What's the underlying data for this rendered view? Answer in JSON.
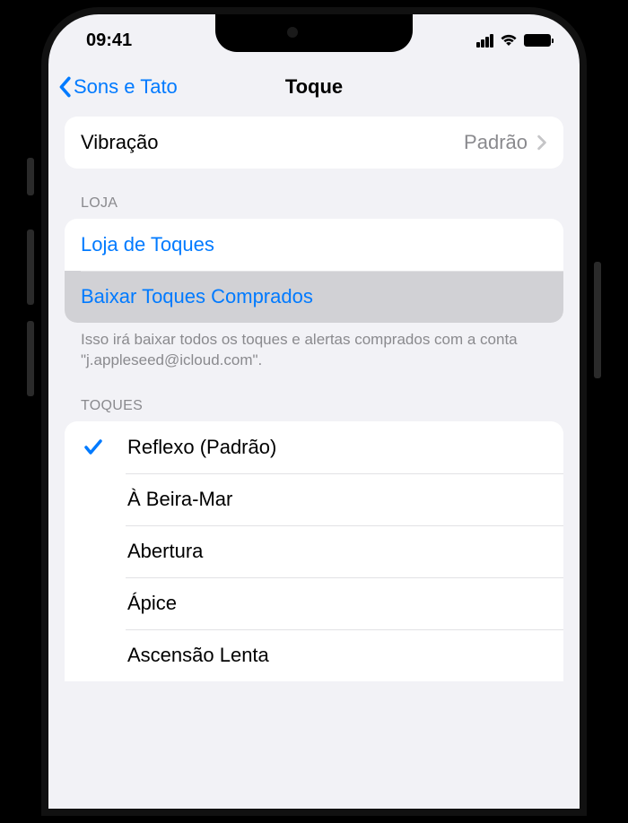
{
  "status": {
    "time": "09:41"
  },
  "nav": {
    "back_label": "Sons e Tato",
    "title": "Toque"
  },
  "vibration": {
    "label": "Vibração",
    "value": "Padrão"
  },
  "store": {
    "header": "LOJA",
    "tone_store_label": "Loja de Toques",
    "download_label": "Baixar Toques Comprados",
    "footer": "Isso irá baixar todos os toques e alertas comprados com a conta \"j.appleseed@icloud.com\"."
  },
  "ringtones": {
    "header": "TOQUES",
    "items": [
      {
        "label": "Reflexo (Padrão)",
        "selected": true
      },
      {
        "label": "À Beira-Mar",
        "selected": false
      },
      {
        "label": "Abertura",
        "selected": false
      },
      {
        "label": "Ápice",
        "selected": false
      },
      {
        "label": "Ascensão Lenta",
        "selected": false
      }
    ]
  }
}
